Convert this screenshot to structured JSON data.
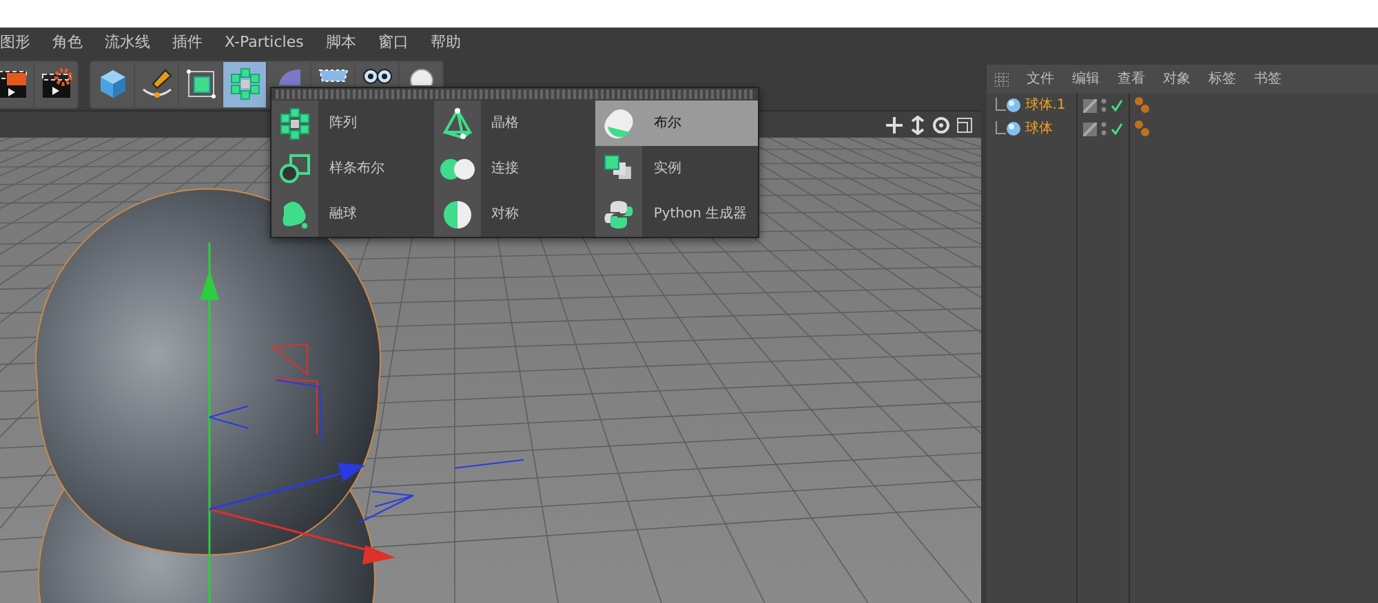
{
  "menu_bar": [
    "图形",
    "角色",
    "流水线",
    "插件",
    "X-Particles",
    "脚本",
    "窗口",
    "帮助"
  ],
  "toolbar": [
    {
      "selected": false
    },
    {
      "selected": false
    },
    {
      "selected": false
    },
    {
      "selected": false
    },
    {
      "selected": false
    },
    {
      "selected": true
    },
    {
      "selected": false
    },
    {
      "selected": false
    },
    {
      "selected": false
    },
    {
      "selected": false
    }
  ],
  "popup_menu": [
    {
      "label": "阵列",
      "selected": false
    },
    {
      "label": "晶格",
      "selected": false
    },
    {
      "label": "布尔",
      "selected": true
    },
    {
      "label": "样条布尔",
      "selected": false
    },
    {
      "label": "连接",
      "selected": false
    },
    {
      "label": "实例",
      "selected": false
    },
    {
      "label": "融球",
      "selected": false
    },
    {
      "label": "对称",
      "selected": false
    },
    {
      "label": "Python 生成器",
      "selected": false
    }
  ],
  "object_manager": {
    "menu": [
      "文件",
      "编辑",
      "查看",
      "对象",
      "标签",
      "书签"
    ],
    "objects": [
      {
        "name": "球体.1",
        "selected": true,
        "enabled": true
      },
      {
        "name": "球体",
        "selected": true,
        "enabled": true
      }
    ]
  }
}
